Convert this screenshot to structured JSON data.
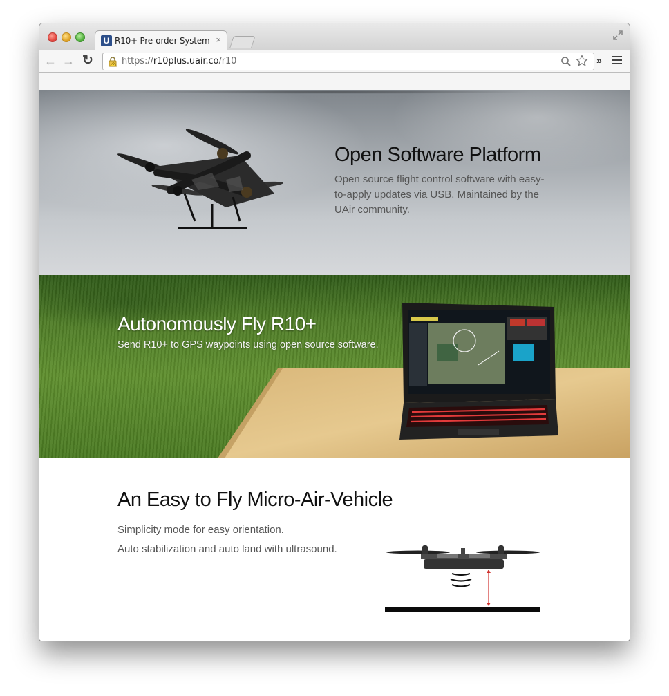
{
  "browser": {
    "tab_title": "R10+ Pre-order System",
    "tab_logo_letter": "U",
    "tab_close": "×",
    "url_protocol": "https://",
    "url_host": "r10plus.uair.co",
    "url_path": "/r10",
    "extensions_label": "»",
    "back_glyph": "←",
    "forward_glyph": "→",
    "reload_glyph": "↻"
  },
  "sections": {
    "open_software": {
      "heading": "Open Software Platform",
      "body": "Open source flight control software with easy-to-apply updates via USB. Maintained by the UAir community."
    },
    "autonomous": {
      "heading": "Autonomously Fly R10+",
      "body": "Send R10+ to GPS waypoints using open source software."
    },
    "easy_fly": {
      "heading": "An Easy to Fly Micro-Air-Vehicle",
      "line1": "Simplicity mode for easy orientation.",
      "line2": "Auto stabilization and auto land with ultrasound."
    }
  },
  "icons": [
    "lock-warning-icon",
    "search-icon",
    "star-icon",
    "menu-icon",
    "fullscreen-icon"
  ],
  "colors": {
    "heading_dark": "#111111",
    "body_gray": "#555555",
    "grass_green": "#5f8f2e",
    "altitude_arrow": "#d0312d"
  }
}
